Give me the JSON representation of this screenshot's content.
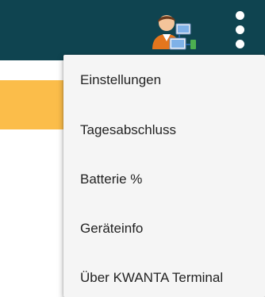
{
  "colors": {
    "toolbar_bg": "#0f4450",
    "accent_orange": "#fbbd4a",
    "menu_bg": "#f5f5f5",
    "menu_text": "#222222"
  },
  "toolbar": {
    "account_icon": "user-network-icon",
    "overflow_icon": "more-vertical-icon"
  },
  "menu": {
    "items": [
      {
        "label": "Einstellungen"
      },
      {
        "label": "Tagesabschluss"
      },
      {
        "label": "Batterie %"
      },
      {
        "label": "Geräteinfo"
      },
      {
        "label": "Über KWANTA Terminal"
      }
    ]
  }
}
